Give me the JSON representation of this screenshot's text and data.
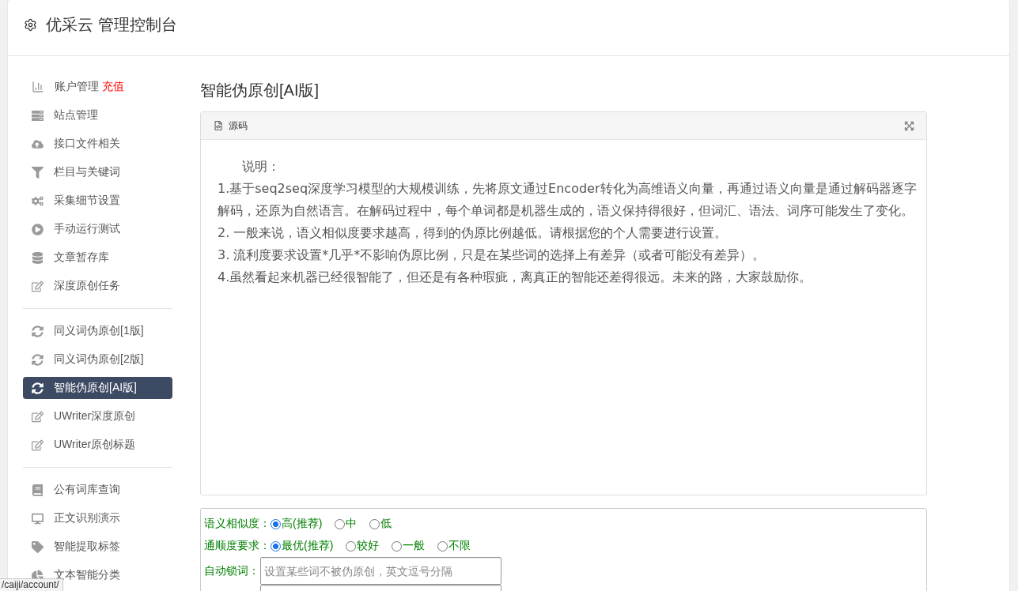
{
  "header": {
    "title": "优采云 管理控制台"
  },
  "sidebar": {
    "groups": [
      {
        "items": [
          {
            "label": "账户管理",
            "badge": "充值",
            "selected": false
          },
          {
            "label": "站点管理",
            "selected": false
          },
          {
            "label": "接口文件相关",
            "selected": false
          },
          {
            "label": "栏目与关键词",
            "selected": false
          },
          {
            "label": "采集细节设置",
            "selected": false
          },
          {
            "label": "手动运行测试",
            "selected": false
          },
          {
            "label": "文章暂存库",
            "selected": false
          },
          {
            "label": "深度原创任务",
            "selected": false
          }
        ]
      },
      {
        "items": [
          {
            "label": "同义词伪原创[1版]",
            "selected": false
          },
          {
            "label": "同义词伪原创[2版]",
            "selected": false
          },
          {
            "label": "智能伪原创[AI版]",
            "selected": true
          },
          {
            "label": "UWriter深度原创",
            "selected": false
          },
          {
            "label": "UWriter原创标题",
            "selected": false
          }
        ]
      },
      {
        "items": [
          {
            "label": "公有词库查询",
            "selected": false
          },
          {
            "label": "正文识别演示",
            "selected": false
          },
          {
            "label": "智能提取标签",
            "selected": false
          },
          {
            "label": "文本智能分类",
            "selected": false
          }
        ]
      }
    ]
  },
  "page": {
    "title": "智能伪原创[AI版]"
  },
  "editor": {
    "toolbar": {
      "source_label": "源码"
    },
    "intro": "说明：",
    "paragraphs": [
      "1.基于seq2seq深度学习模型的大规模训练，先将原文通过Encoder转化为高维语义向量，再通过语义向量是通过解码器逐字解码，还原为自然语言。在解码过程中，每个单词都是机器生成的，语义保持得很好，但词汇、语法、词序可能发生了变化。",
      "2. 一般来说，语义相似度要求越高，得到的伪原比例越低。请根据您的个人需要进行设置。",
      "3. 流利度要求设置*几乎*不影响伪原比例，只是在某些词的选择上有差异（或者可能没有差异）。",
      "4.虽然看起来机器已经很智能了，但还是有各种瑕疵，离真正的智能还差得很远。未来的路，大家鼓励你。"
    ]
  },
  "settings": [
    {
      "kind": "radio",
      "label": "语义相似度：",
      "options": [
        {
          "label": "高(推荐)",
          "selected": true
        },
        {
          "label": "中",
          "selected": false
        },
        {
          "label": "低",
          "selected": false
        }
      ]
    },
    {
      "kind": "radio",
      "label": "通顺度要求：",
      "options": [
        {
          "label": "最优(推荐)",
          "selected": true
        },
        {
          "label": "较好",
          "selected": false
        },
        {
          "label": "一般",
          "selected": false
        },
        {
          "label": "不限",
          "selected": false
        }
      ]
    },
    {
      "kind": "input",
      "label": "自动锁词：",
      "placeholder": "设置某些词不被伪原创，英文逗号分隔"
    },
    {
      "kind": "input"
    }
  ],
  "status_bar": {
    "url": "/caiji/account/"
  }
}
